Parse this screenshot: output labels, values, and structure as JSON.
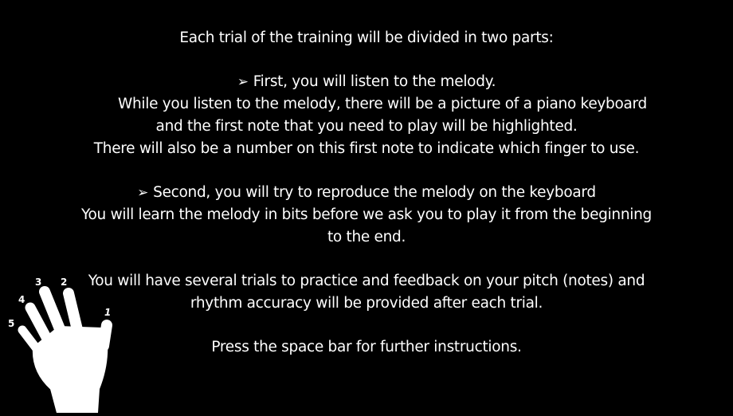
{
  "instructions": {
    "heading": "Each trial of the training will be divided in two parts:",
    "part1": {
      "bullet": "➢",
      "title": "First, you will listen to the melody.",
      "line1": "While you listen to the melody, there will be a picture of a piano keyboard",
      "line2": "and the first note that you need to play will be highlighted.",
      "line3": "There will also be a number on this first note to indicate which finger to use."
    },
    "part2": {
      "bullet": "➢",
      "title": "Second, you will try to reproduce the melody on the keyboard",
      "line1": "You will learn the melody in bits before we ask you to play it from the beginning",
      "line2": "to the end."
    },
    "feedback": {
      "line1": "You will have several trials to practice and feedback on your pitch (notes) and",
      "line2": "rhythm accuracy will be provided after each trial."
    },
    "prompt": "Press the space bar for further instructions."
  },
  "hand": {
    "finger_labels": [
      "1",
      "2",
      "3",
      "4",
      "5"
    ]
  },
  "colors": {
    "background": "#000000",
    "text": "#ffffff"
  }
}
